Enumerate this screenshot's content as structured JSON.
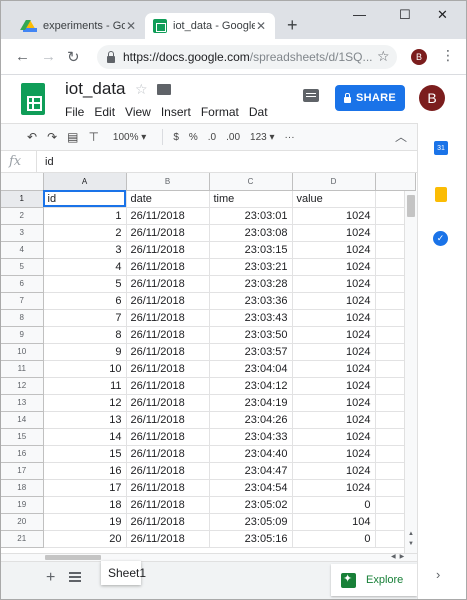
{
  "browser": {
    "tabs": [
      {
        "title": "experiments - Goo",
        "active": false
      },
      {
        "title": "iot_data - Google",
        "active": true
      }
    ],
    "new_tab_label": "+",
    "url_host": "https://docs.google.com",
    "url_path": "/spreadsheets/d/1SQ...",
    "profile_initial": "B",
    "window_controls": {
      "minimize": "—",
      "maximize": "☐",
      "close": "✕"
    }
  },
  "doc": {
    "title": "iot_data",
    "menu": [
      "File",
      "Edit",
      "View",
      "Insert",
      "Format",
      "Dat"
    ],
    "share_label": "SHARE",
    "avatar_initial": "B"
  },
  "toolbar": {
    "zoom": "100%",
    "currency": "$",
    "percent": "%",
    "dec_decrease": ".0",
    "dec_increase": ".00",
    "more_formats": "123",
    "more": "···"
  },
  "formula_bar": {
    "fx_label": "fx",
    "value": "id"
  },
  "sheet": {
    "columns": [
      "A",
      "B",
      "C",
      "D"
    ],
    "rows": [
      {
        "n": "1",
        "id": "id",
        "date": "date",
        "time": "time",
        "value": "value"
      },
      {
        "n": "2",
        "id": "1",
        "date": "26/11/2018",
        "time": "23:03:01",
        "value": "1024"
      },
      {
        "n": "3",
        "id": "2",
        "date": "26/11/2018",
        "time": "23:03:08",
        "value": "1024"
      },
      {
        "n": "4",
        "id": "3",
        "date": "26/11/2018",
        "time": "23:03:15",
        "value": "1024"
      },
      {
        "n": "5",
        "id": "4",
        "date": "26/11/2018",
        "time": "23:03:21",
        "value": "1024"
      },
      {
        "n": "6",
        "id": "5",
        "date": "26/11/2018",
        "time": "23:03:28",
        "value": "1024"
      },
      {
        "n": "7",
        "id": "6",
        "date": "26/11/2018",
        "time": "23:03:36",
        "value": "1024"
      },
      {
        "n": "8",
        "id": "7",
        "date": "26/11/2018",
        "time": "23:03:43",
        "value": "1024"
      },
      {
        "n": "9",
        "id": "8",
        "date": "26/11/2018",
        "time": "23:03:50",
        "value": "1024"
      },
      {
        "n": "10",
        "id": "9",
        "date": "26/11/2018",
        "time": "23:03:57",
        "value": "1024"
      },
      {
        "n": "11",
        "id": "10",
        "date": "26/11/2018",
        "time": "23:04:04",
        "value": "1024"
      },
      {
        "n": "12",
        "id": "11",
        "date": "26/11/2018",
        "time": "23:04:12",
        "value": "1024"
      },
      {
        "n": "13",
        "id": "12",
        "date": "26/11/2018",
        "time": "23:04:19",
        "value": "1024"
      },
      {
        "n": "14",
        "id": "13",
        "date": "26/11/2018",
        "time": "23:04:26",
        "value": "1024"
      },
      {
        "n": "15",
        "id": "14",
        "date": "26/11/2018",
        "time": "23:04:33",
        "value": "1024"
      },
      {
        "n": "16",
        "id": "15",
        "date": "26/11/2018",
        "time": "23:04:40",
        "value": "1024"
      },
      {
        "n": "17",
        "id": "16",
        "date": "26/11/2018",
        "time": "23:04:47",
        "value": "1024"
      },
      {
        "n": "18",
        "id": "17",
        "date": "26/11/2018",
        "time": "23:04:54",
        "value": "1024"
      },
      {
        "n": "19",
        "id": "18",
        "date": "26/11/2018",
        "time": "23:05:02",
        "value": "0"
      },
      {
        "n": "20",
        "id": "19",
        "date": "26/11/2018",
        "time": "23:05:09",
        "value": "104"
      },
      {
        "n": "21",
        "id": "20",
        "date": "26/11/2018",
        "time": "23:05:16",
        "value": "0"
      }
    ]
  },
  "bottom": {
    "add_sheet": "+",
    "sheet_tab": "Sheet1",
    "explore_label": "Explore"
  },
  "colors": {
    "accent": "#1a73e8",
    "sheets_green": "#0f9d58",
    "explore_green": "#188038",
    "avatar": "#7b1d1d"
  }
}
